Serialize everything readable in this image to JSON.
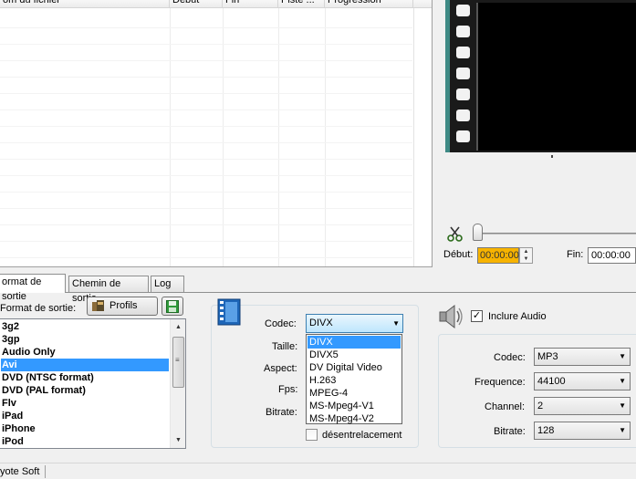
{
  "file_list": {
    "columns": [
      "om du fichier",
      "Debut",
      "Fin",
      "Piste ...",
      "Progression"
    ]
  },
  "preview": {
    "start_label": "Début:",
    "start_value": "00:00:00",
    "end_label": "Fin:",
    "end_value": "00:00:00"
  },
  "tabs": [
    {
      "label": "ormat de sortie"
    },
    {
      "label": "Chemin de sortie"
    },
    {
      "label": "Log"
    }
  ],
  "format_panel": {
    "label": "Format de sortie:",
    "profiles_button": "Profils",
    "formats": [
      "3g2",
      "3gp",
      "Audio Only",
      "Avi",
      "DVD (NTSC format)",
      "DVD (PAL format)",
      "Flv",
      "iPad",
      "iPhone",
      "iPod"
    ],
    "selected": "Avi"
  },
  "video": {
    "codec_label": "Codec:",
    "codec_value": "DIVX",
    "size_label": "Taille:",
    "aspect_label": "Aspect:",
    "fps_label": "Fps:",
    "bitrate_label": "Bitrate:",
    "codec_options": [
      "DIVX",
      "DIVX5",
      "DV Digital Video",
      "H.263",
      "MPEG-4",
      "MS-Mpeg4-V1",
      "MS-Mpeg4-V2"
    ],
    "deinterlace_label": "désentrelacement"
  },
  "audio": {
    "include_label": "Inclure Audio",
    "include_checked": true,
    "codec_label": "Codec:",
    "codec_value": "MP3",
    "frequency_label": "Frequence:",
    "frequency_value": "44100",
    "channel_label": "Channel:",
    "channel_value": "2",
    "bitrate_label": "Bitrate:",
    "bitrate_value": "128"
  },
  "status": {
    "text": "yote Soft"
  },
  "colors": {
    "selection": "#3399ff",
    "start_time_bg": "#f7b300",
    "film_accent": "#3e8a85"
  }
}
